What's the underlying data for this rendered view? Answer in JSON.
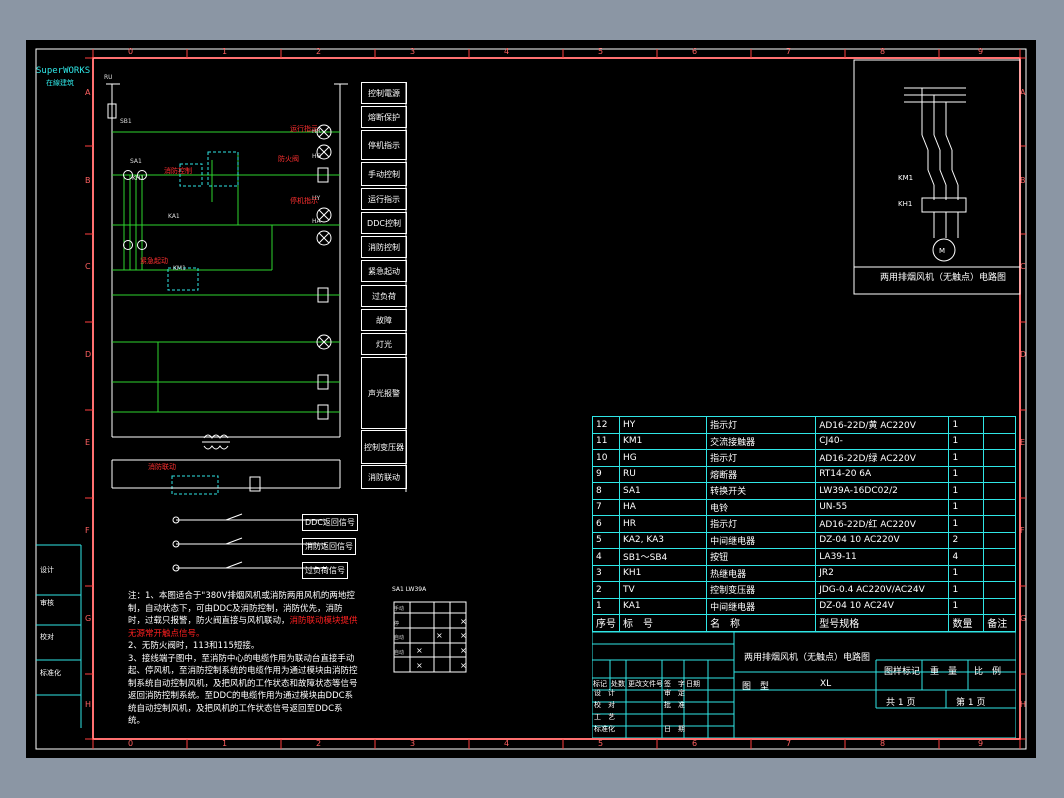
{
  "logo": {
    "brand": "SuperWORKS",
    "sub": "在線建筑"
  },
  "col_markers": [
    "0",
    "1",
    "2",
    "3",
    "4",
    "5",
    "6",
    "7",
    "8",
    "9"
  ],
  "row_markers": [
    "A",
    "B",
    "C",
    "D",
    "E",
    "F",
    "G",
    "H"
  ],
  "control_labels": [
    "控制電源",
    "熔断保护",
    "停机指示",
    "手动控制",
    "运行指示",
    "DDC控制",
    "消防控制",
    "紧急起动",
    "过负荷",
    "故障",
    "灯光",
    "声光报警",
    "控制变压器",
    "消防联动"
  ],
  "signal_labels": [
    "DDC返回信号",
    "消防返回信号",
    "过负荷信号"
  ],
  "circuit_labels": [
    "SB1",
    "SA1",
    "KH1",
    "KA1",
    "KM1",
    "HR",
    "HG",
    "HY",
    "HA",
    "RU"
  ],
  "red_labels": [
    "运行指示",
    "停机指示",
    "防火阀",
    "消防控制",
    "紧急起动",
    "消防联动"
  ],
  "motor": {
    "title": "两用排烟风机（无触点）电路图",
    "motor_label": "M",
    "km": "KM1",
    "kh": "KH1"
  },
  "notes": {
    "line1": "注：1、本图适合于\"380V排烟风机或消防两用风机的两地控制，自动状态下，可由DDC及消防控制，消防优先，消防时，过载只报警，防火阀直接与风机联动，",
    "line1_red": "消防联动模块提供无源常开触点信号。",
    "line2": "2、无防火阀时，113和115短接。",
    "line3": "3、接线端子图中，至消防中心的电缆作用为联动台直接手动起、停风机，至消防控制系统的电缆作用为通过模块由消防控制系统自动控制风机，及把风机的工作状态和故障状态等信号返回消防控制系统。至DDC的电缆作用为通过模块由DDC系统自动控制风机，及把风机的工作状态信号返回至DDC系统。"
  },
  "selector": {
    "title": "SA1 LW39A",
    "rows": [
      "手动",
      "停",
      "自动",
      "自动"
    ]
  },
  "parts": {
    "header": [
      "序号",
      "标　号",
      "名　称",
      "型号规格",
      "数量",
      "备注"
    ],
    "rows": [
      [
        "12",
        "HY",
        "指示灯",
        "AD16-22D/黄 AC220V",
        "1",
        ""
      ],
      [
        "11",
        "KM1",
        "交流接触器",
        "CJ40-",
        "1",
        ""
      ],
      [
        "10",
        "HG",
        "指示灯",
        "AD16-22D/绿 AC220V",
        "1",
        ""
      ],
      [
        "9",
        "RU",
        "熔断器",
        "RT14-20 6A",
        "1",
        ""
      ],
      [
        "8",
        "SA1",
        "转换开关",
        "LW39A-16DC02/2",
        "1",
        ""
      ],
      [
        "7",
        "HA",
        "电铃",
        "UN-55",
        "1",
        ""
      ],
      [
        "6",
        "HR",
        "指示灯",
        "AD16-22D/红 AC220V",
        "1",
        ""
      ],
      [
        "5",
        "KA2, KA3",
        "中间继电器",
        "DZ-04 10 AC220V",
        "2",
        ""
      ],
      [
        "4",
        "SB1～SB4",
        "按钮",
        "LA39-11",
        "4",
        ""
      ],
      [
        "3",
        "KH1",
        "热继电器",
        "JR2",
        "1",
        ""
      ],
      [
        "2",
        "TV",
        "控制变压器",
        "JDG-0.4 AC220V/AC24V",
        "1",
        ""
      ],
      [
        "1",
        "KA1",
        "中间继电器",
        "DZ-04 10 AC24V",
        "1",
        ""
      ]
    ]
  },
  "title_block": {
    "drawing_title": "两用排烟风机（无触点）电路图",
    "type_label": "图　型",
    "type_value": "XL",
    "stage_label": "图样标记",
    "weight_label": "重　量",
    "scale_label": "比　例",
    "total_label": "共 1 页",
    "page_label": "第 1 页",
    "rev": [
      "标记",
      "处数",
      "更改文件号",
      "签　字",
      "日期"
    ],
    "roles": [
      "设　计",
      "校　对",
      "工　艺",
      "标准化"
    ],
    "roles2": [
      "审　定",
      "批　准",
      "日　期"
    ]
  },
  "left_strip": [
    "设计",
    "审核",
    "校对",
    "标准化"
  ],
  "colors": {
    "grid": "#ff4040",
    "border": "#ffffff",
    "table": "#2fe6e6",
    "wire_green": "#2ed42e",
    "wire_white": "#ffffff",
    "lamp": "#ffffff"
  }
}
